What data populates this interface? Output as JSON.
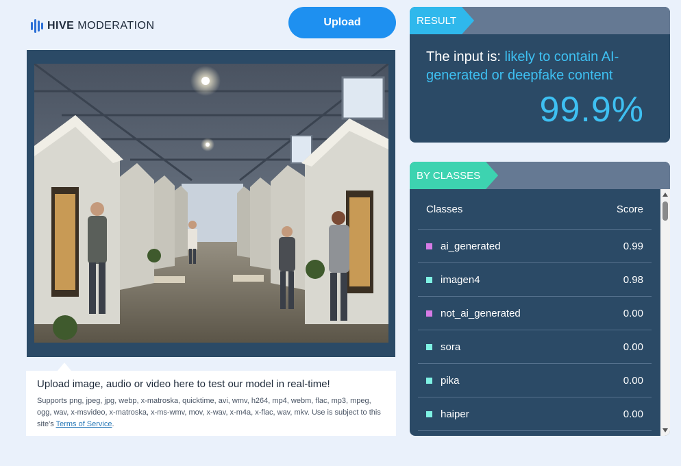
{
  "header": {
    "logo_bold": "HIVE",
    "logo_light": "MODERATION",
    "upload_label": "Upload",
    "brand_color": "#2b6fd6",
    "button_color": "#1e90f0"
  },
  "upload_info": {
    "headline": "Upload image, audio or video here to test our model in real-time!",
    "supports_text": "Supports png, jpeg, jpg, webp, x-matroska, quicktime, avi, wmv, h264, mp4, webm, flac, mp3, mpeg, ogg, wav, x-msvideo, x-matroska, x-ms-wmv, mov, x-wav, x-m4a, x-flac, wav, mkv. Use is subject to this site's ",
    "terms_link": "Terms of Service",
    "terms_suffix": "."
  },
  "result": {
    "tag": "RESULT",
    "prefix": "The input is: ",
    "verdict": "likely to contain AI-generated or deepfake content",
    "score": "99.9%",
    "accent": "#3ec0f2"
  },
  "classes": {
    "tag": "BY CLASSES",
    "col_class": "Classes",
    "col_score": "Score",
    "rows": [
      {
        "name": "ai_generated",
        "score": "0.99",
        "color": "#d77be6"
      },
      {
        "name": "imagen4",
        "score": "0.98",
        "color": "#7ff2e4"
      },
      {
        "name": "not_ai_generated",
        "score": "0.00",
        "color": "#d77be6"
      },
      {
        "name": "sora",
        "score": "0.00",
        "color": "#7ff2e4"
      },
      {
        "name": "pika",
        "score": "0.00",
        "color": "#7ff2e4"
      },
      {
        "name": "haiper",
        "score": "0.00",
        "color": "#7ff2e4"
      }
    ]
  }
}
